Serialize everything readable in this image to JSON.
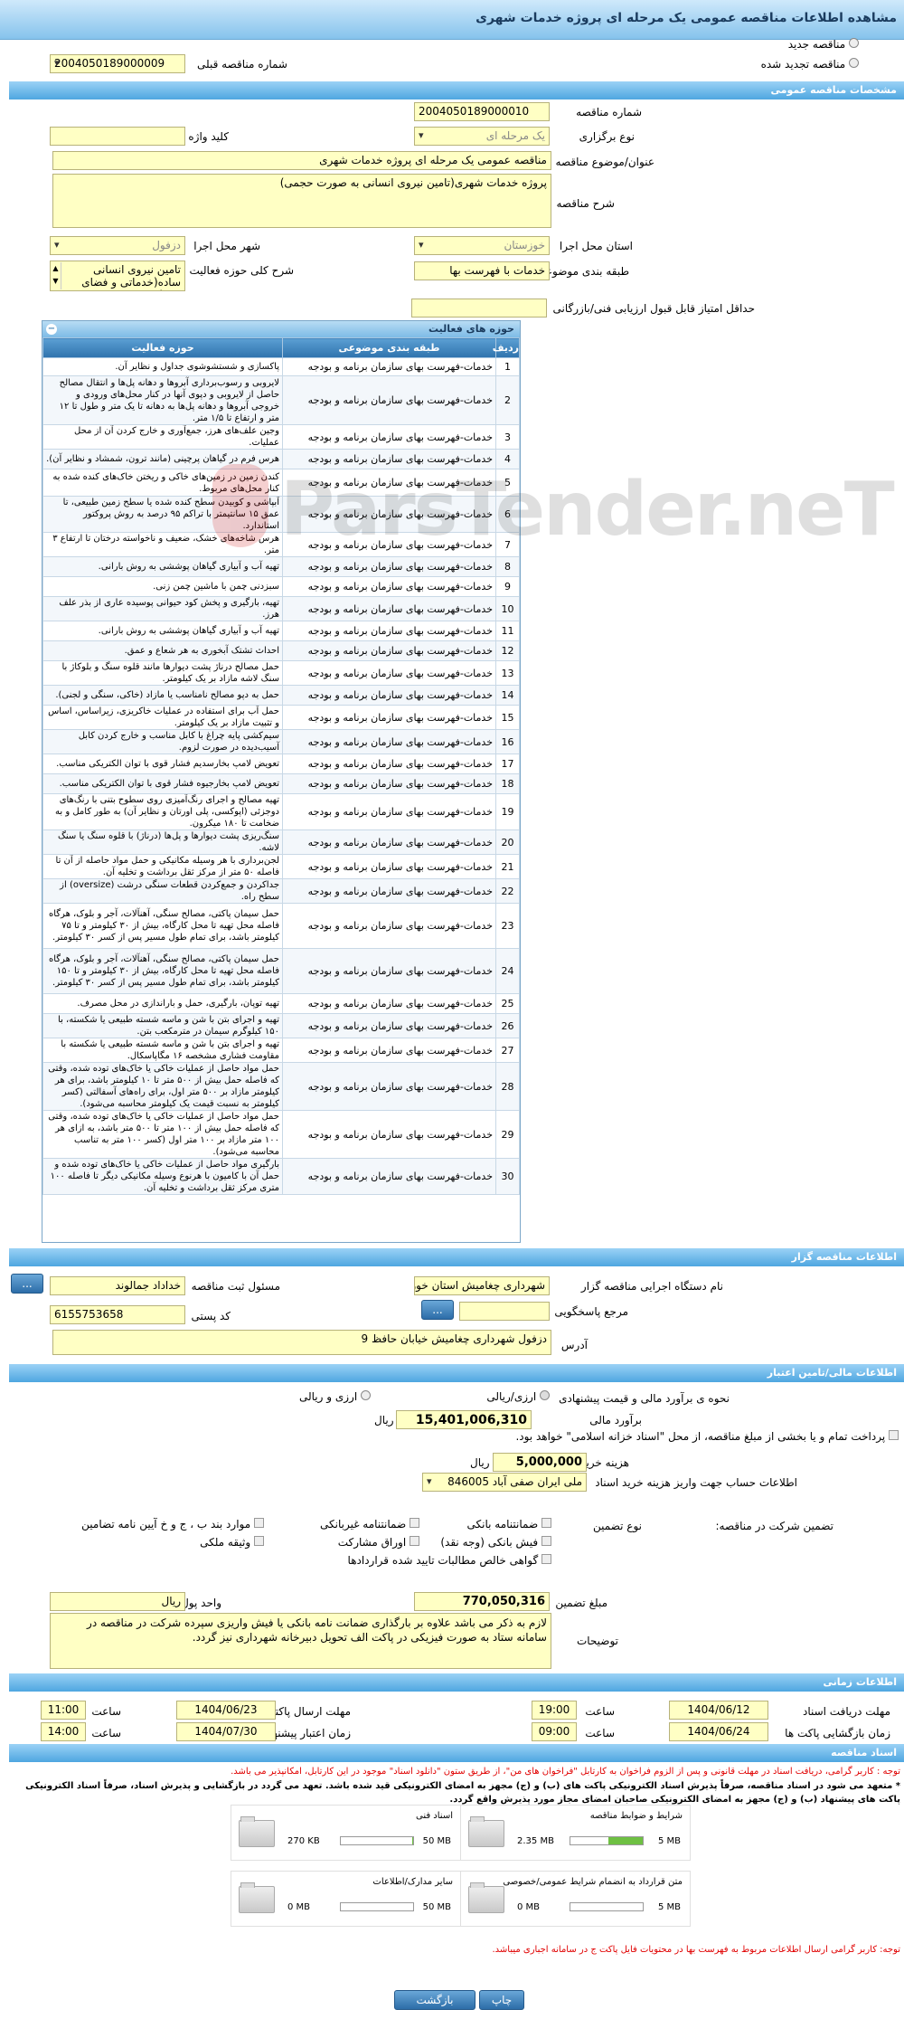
{
  "page_title": "مشاهده اطلاعات مناقصه عمومی یک مرحله ای پروژه خدمات شهری",
  "radio_new": "مناقصه جدید",
  "radio_renew": "مناقصه تجدید شده",
  "prev_tender_label": "شماره مناقصه قبلی",
  "prev_tender_value": "2004050189000009",
  "sections": {
    "general": "مشخصات مناقصه عمومی",
    "organizer": "اطلاعات مناقصه گزار",
    "finance": "اطلاعات مالی/تامین اعتبار",
    "time": "اطلاعات زمانی",
    "docs": "اسناد مناقصه"
  },
  "general": {
    "tender_no_label": "شماره مناقصه",
    "tender_no": "2004050189000010",
    "type_label": "نوع برگزاری",
    "type_value": "یک مرحله ای",
    "keyword_label": "کلید واژه",
    "subject_label": "عنوان/موضوع مناقصه",
    "subject_value": "مناقصه عمومی یک مرحله ای پروژه خدمات شهری",
    "desc_label": "شرح مناقصه",
    "desc_value": "پروژه خدمات شهری(تامین نیروی انسانی به صورت حجمی)",
    "province_label": "استان محل اجرا",
    "province_value": "خوزستان",
    "city_label": "شهر محل اجرا",
    "city_value": "دزفول",
    "category_label": "طبقه بندی موضوعی",
    "category_value": "خدمات با فهرست بها",
    "scope_label": "شرح کلی حوزه فعالیت",
    "scope_value": "تامین نیروی انسانی ساده(خدماتی و فضای سبز)",
    "min_score_label": "حداقل امتیاز قابل قبول ارزیابی فنی/بازرگانی"
  },
  "activity": {
    "title": "حوزه های فعالیت",
    "col_row": "ردیف",
    "col_cat": "طبقه بندی موضوعی",
    "col_area": "حوزه فعالیت",
    "rows": [
      {
        "n": "1",
        "cat": "خدمات-فهرست بهای سازمان برنامه و بودجه",
        "area": "پاکسازی و شستشوشوی جداول و نظایر آن."
      },
      {
        "n": "2",
        "cat": "خدمات-فهرست بهای سازمان برنامه و بودجه",
        "area": "لایروبی و رسوب‌برداری آبروها و دهانه پل‌ها و انتقال مصالح حاصل از لایروبی و دپوی آنها در کنار محل‌های ورودی و خروجی آبروها و دهانه پل‌ها به دهانه تا یک متر و طول تا ۱۲ متر و ارتفاع تا ۱/۵ متر."
      },
      {
        "n": "3",
        "cat": "خدمات-فهرست بهای سازمان برنامه و بودجه",
        "area": "وجین علف‌های هرز، جمع‌آوری و خارج کردن آن از محل عملیات."
      },
      {
        "n": "4",
        "cat": "خدمات-فهرست بهای سازمان برنامه و بودجه",
        "area": "هرس فرم در گیاهان پرچینی (مانند ترون، شمشاد و نظایر آن)."
      },
      {
        "n": "5",
        "cat": "خدمات-فهرست بهای سازمان برنامه و بودجه",
        "area": "کندن زمین در زمین‌های خاکی و ریختن خاک‌های کنده شده به کنار محل‌های مربوط."
      },
      {
        "n": "6",
        "cat": "خدمات-فهرست بهای سازمان برنامه و بودجه",
        "area": "آبپاشی و کوبیدن سطح کنده شده یا سطح زمین طبیعی، تا عمق ۱۵ سانتیمتر با تراکم ۹۵ درصد به روش پروکتور استاندارد."
      },
      {
        "n": "7",
        "cat": "خدمات-فهرست بهای سازمان برنامه و بودجه",
        "area": "هرس شاخه‌های خشک، ضعیف و ناخواسته درختان تا ارتفاع ۳ متر."
      },
      {
        "n": "8",
        "cat": "خدمات-فهرست بهای سازمان برنامه و بودجه",
        "area": "تهیه آب و آبیاری گیاهان پوششی به روش بارانی."
      },
      {
        "n": "9",
        "cat": "خدمات-فهرست بهای سازمان برنامه و بودجه",
        "area": "سبزدنی چمن با ماشین چمن زنی."
      },
      {
        "n": "10",
        "cat": "خدمات-فهرست بهای سازمان برنامه و بودجه",
        "area": "تهیه، بارگیری و پخش کود حیوانی پوسیده عاری از بذر علف هرز."
      },
      {
        "n": "11",
        "cat": "خدمات-فهرست بهای سازمان برنامه و بودجه",
        "area": "تهیه آب و آبیاری گیاهان پوششی به روش بارانی."
      },
      {
        "n": "12",
        "cat": "خدمات-فهرست بهای سازمان برنامه و بودجه",
        "area": "احداث تشتک آبخوری به هر شعاع و عمق."
      },
      {
        "n": "13",
        "cat": "خدمات-فهرست بهای سازمان برنامه و بودجه",
        "area": "حمل مصالح درناژ پشت دیوارها مانند قلوه سنگ و بلوکاژ با سنگ لاشه مازاد بر یک کیلومتر."
      },
      {
        "n": "14",
        "cat": "خدمات-فهرست بهای سازمان برنامه و بودجه",
        "area": "حمل به دپو مصالح نامناسب یا مازاد (خاکی، سنگی و لجنی)."
      },
      {
        "n": "15",
        "cat": "خدمات-فهرست بهای سازمان برنامه و بودجه",
        "area": "حمل آب برای استفاده در عملیات خاکریزی، زیراساس، اساس و تثبیت مازاد بر یک کیلومتر."
      },
      {
        "n": "16",
        "cat": "خدمات-فهرست بهای سازمان برنامه و بودجه",
        "area": "سیم‌کشی پایه چراغ با کابل مناسب و خارج کردن کابل آسیب‌دیده در صورت لزوم."
      },
      {
        "n": "17",
        "cat": "خدمات-فهرست بهای سازمان برنامه و بودجه",
        "area": "تعویض لامپ بخارسدیم فشار قوی با توان الکتریکی مناسب."
      },
      {
        "n": "18",
        "cat": "خدمات-فهرست بهای سازمان برنامه و بودجه",
        "area": "تعویض لامپ بخارجیوه فشار قوی با توان الکتریکی مناسب."
      },
      {
        "n": "19",
        "cat": "خدمات-فهرست بهای سازمان برنامه و بودجه",
        "area": "تهیه مصالح و اجرای رنگ‌آمیزی روی سطوح بتنی با رنگ‌های دوجزئی (اپوکسی، پلی اورتان و نظایر آن) به طور کامل و به ضخامت تا ۱۸۰ میکرون."
      },
      {
        "n": "20",
        "cat": "خدمات-فهرست بهای سازمان برنامه و بودجه",
        "area": "سنگ‌ریزی پشت دیوارها و پل‌ها (درناژ) با قلوه سنگ یا سنگ لاشه."
      },
      {
        "n": "21",
        "cat": "خدمات-فهرست بهای سازمان برنامه و بودجه",
        "area": "لجن‌برداری با هر وسیله مکانیکی و حمل مواد حاصله از آن تا فاصله ۵۰ متر از مرکز ثقل برداشت و تخلیه آن."
      },
      {
        "n": "22",
        "cat": "خدمات-فهرست بهای سازمان برنامه و بودجه",
        "area": "جداکردن و جمع‌کردن قطعات سنگی درشت (oversize) از سطح راه."
      },
      {
        "n": "23",
        "cat": "خدمات-فهرست بهای سازمان برنامه و بودجه",
        "area": "حمل سیمان پاکتی، مصالح سنگی، آهنآلات، آجر و بلوک، هرگاه فاصله محل تهیه تا محل کارگاه، بیش از ۳۰ کیلومتر و تا ۷۵ کیلومتر باشد، برای تمام طول مسیر پس از کسر ۳۰ کیلومتر."
      },
      {
        "n": "24",
        "cat": "خدمات-فهرست بهای سازمان برنامه و بودجه",
        "area": "حمل سیمان پاکتی، مصالح سنگی، آهنآلات، آجر و بلوک، هرگاه فاصله محل تهیه تا محل کارگاه، بیش از ۳۰ کیلومتر و تا ۱۵۰ کیلومتر باشد، برای تمام طول مسیر پس از کسر ۳۰ کیلومتر."
      },
      {
        "n": "25",
        "cat": "خدمات-فهرست بهای سازمان برنامه و بودجه",
        "area": "تهیه توپان، بارگیری، حمل و باراندازی در محل مصرف."
      },
      {
        "n": "26",
        "cat": "خدمات-فهرست بهای سازمان برنامه و بودجه",
        "area": "تهیه و اجرای بتن با شن و ماسه شسته طبیعی یا شکسته، با ۱۵۰ کیلوگرم سیمان در مترمکعب بتن."
      },
      {
        "n": "27",
        "cat": "خدمات-فهرست بهای سازمان برنامه و بودجه",
        "area": "تهیه و اجرای بتن با شن و ماسه شسته طبیعی یا شکسته با مقاومت فشاری مشخصه ۱۶ مگاپاسکال."
      },
      {
        "n": "28",
        "cat": "خدمات-فهرست بهای سازمان برنامه و بودجه",
        "area": "حمل مواد حاصل از عملیات خاکی یا خاک‌های توده شده، وقتی که فاصله حمل بیش از ۵۰۰ متر تا ۱۰ کیلومتر باشد، برای هر کیلومتر مازاد بر ۵۰۰ متر اول، برای راه‌های آسفالتی (کسر کیلومتر به نسبت قیمت یک کیلومتر محاسبه می‌شود)."
      },
      {
        "n": "29",
        "cat": "خدمات-فهرست بهای سازمان برنامه و بودجه",
        "area": "حمل مواد حاصل از عملیات خاکی یا خاک‌های توده شده، وقتی که فاصله حمل بیش از ۱۰۰ متر تا ۵۰۰ متر باشد، به ازای هر ۱۰۰ متر مازاد بر ۱۰۰ متر اول (کسر ۱۰۰ متر به تناسب محاسبه می‌شود)."
      },
      {
        "n": "30",
        "cat": "خدمات-فهرست بهای سازمان برنامه و بودجه",
        "area": "بارگیری مواد حاصل از عملیات خاکی یا خاک‌های توده شده و حمل آن با کامیون با هرنوع وسیله مکانیکی دیگر تا فاصله ۱۰۰ متری مرکز ثقل برداشت و تخلیه آن."
      }
    ]
  },
  "organizer": {
    "org_label": "نام دستگاه اجرایی مناقصه گزار",
    "org_value": "شهرداری چغامیش استان خوزستان",
    "resp_label": "مسئول ثبت مناقصه",
    "resp_value": "خداداد جمالوند",
    "ref_label": "مرجع پاسخگویی",
    "postal_label": "کد پستی",
    "postal_value": "6155753658",
    "addr_label": "آدرس",
    "addr_value": "دزفول شهرداری چغامیش خیابان حافظ 9",
    "dots": "..."
  },
  "finance": {
    "estimate_method_label": "نحوه ی برآورد مالی و قیمت پیشنهادی",
    "opt_rial": "ارزی/ریالی",
    "opt_both": "ارزی و ریالی",
    "estimate_label": "برآورد مالی",
    "estimate_value": "15,401,006,310",
    "rial": "ریال",
    "payment_note": "پرداخت تمام و یا بخشی از مبلغ مناقصه، از محل \"اسناد خزانه اسلامی\" خواهد بود.",
    "doc_fee_label": "هزینه خرید اسناد",
    "doc_fee_value": "5,000,000",
    "account_label": "اطلاعات حساب جهت واریز هزینه خرید اسناد",
    "account_value": "ملی ایران صفی آباد 846005",
    "guarantee_label": "تضمین شرکت در مناقصه:",
    "guarantee_type_label": "نوع تضمین",
    "g_bank": "ضمانتنامه بانکی",
    "g_nonbank": "ضمانتنامه غیربانکی",
    "g_clauses": "موارد بند ب ، ج و خ آیین نامه تضامین",
    "g_check": "فیش بانکی (وجه نقد)",
    "g_bonds": "اوراق مشارکت",
    "g_property": "وثیقه ملکی",
    "g_claims": "گواهی خالص مطالبات تایید شده قراردادها",
    "amount_label": "مبلغ تضمین",
    "amount_value": "770,050,316",
    "unit_label": "واحد پول",
    "unit_value": "ریال",
    "notes_label": "توضیحات",
    "notes_value": "لازم به ذکر می باشد علاوه بر بارگذاری ضمانت نامه بانکی یا فیش واریزی سپرده شرکت در مناقصه در سامانه ستاد به صورت فیزیکی در پاکت الف تحویل دبیرخانه شهرداری نیز گردد."
  },
  "time": {
    "receive_label": "مهلت دریافت اسناد",
    "receive_date": "1404/06/12",
    "receive_time": "19:00",
    "send_label": "مهلت ارسال پاکتهای پیشنهاد",
    "send_date": "1404/06/23",
    "send_time": "11:00",
    "open_label": "زمان بازگشایی پاکت ها",
    "open_date": "1404/06/24",
    "open_time": "09:00",
    "valid_label": "زمان اعتبار پیشنهاد",
    "valid_date": "1404/07/30",
    "valid_time": "14:00",
    "time_label": "ساعت"
  },
  "docs": {
    "note1": "توجه : کاربر گرامی، دریافت اسناد در مهلت قانونی و پس از الزوم فراخوان به کارتابل \"فراخوان های من\"، از طریق ستون \"دانلود اسناد\" موجود در این کارتابل، امکانپذیر می باشد.",
    "note2": "* متعهد می شود در اسناد مناقصه، صرفاً پذیرش اسناد الکترونیکی پاکت های (ب) و (ج) مجهز به امضای الکترونیکی قید شده باشد. تعهد می گردد در بازگشایی و پذیرش اسناد، صرفاً اسناد الکترونیکی پاکت های پیشنهاد (ب) و (ج) مجهز به امضای الکترونیکی صاحبان امضای مجاز مورد پذیرش واقع گردد.",
    "files": [
      {
        "name": "شرایط و ضوابط مناقصه",
        "size": "2.35 MB",
        "max": "5 MB",
        "fill": 0.47
      },
      {
        "name": "اسناد فنی",
        "size": "270 KB",
        "max": "50 MB",
        "fill": 0.01
      },
      {
        "name": "متن قرارداد به انضمام شرایط عمومی/خصوصی",
        "size": "0 MB",
        "max": "5 MB",
        "fill": 0
      },
      {
        "name": "سایر مدارک/اطلاعات",
        "size": "0 MB",
        "max": "50 MB",
        "fill": 0
      }
    ],
    "note3": "توجه: کاربر گرامی ارسال اطلاعات مربوط به فهرست بها در محتویات فایل پاکت ج در سامانه اجباری میباشد."
  },
  "buttons": {
    "print": "چاپ",
    "back": "بازگشت"
  },
  "watermark": "ParsTender.neT",
  "colors": {
    "accent": "#4ea6e0",
    "input": "#ffffc4",
    "alert": "#e00000"
  }
}
